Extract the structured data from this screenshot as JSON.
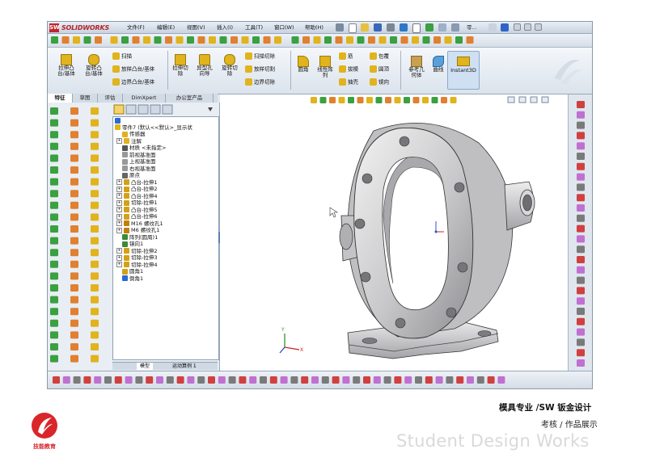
{
  "app": {
    "logo_text": "SOLIDWORKS",
    "menu": [
      "文件(F)",
      "编辑(E)",
      "视图(V)",
      "插入(I)",
      "工具(T)",
      "窗口(W)",
      "帮助(H)"
    ],
    "search_placeholder": "零..."
  },
  "command_manager": {
    "big_buttons": [
      {
        "line1": "拉伸凸",
        "line2": "台/基体"
      },
      {
        "line1": "旋转凸",
        "line2": "台/基体"
      },
      {
        "line1": "拉伸切",
        "line2": "除"
      },
      {
        "line1": "异型孔",
        "line2": "向导"
      },
      {
        "line1": "旋转切",
        "line2": "除"
      }
    ],
    "small_group1": [
      "扫描",
      "放样凸台/基体",
      "边界凸台/基体"
    ],
    "small_group2": [
      "扫描切除",
      "放样切割",
      "边界切除"
    ],
    "features_col1": [
      "圆角"
    ],
    "features_col2": {
      "line1": "线性阵",
      "line2": "列"
    },
    "features_col3": [
      "筋",
      "拔模",
      "抽壳"
    ],
    "features_col4": [
      "包覆",
      "圆顶",
      "镜向"
    ],
    "ref_geometry": {
      "line1": "参考几",
      "line2": "何体"
    },
    "curves": "曲线",
    "instant3d": "Instant3D"
  },
  "tabs": [
    "特征",
    "草图",
    "评估",
    "DimXpert",
    "办公室产品"
  ],
  "tree": {
    "root": "零件7 (默认<<默认>_显示状",
    "nodes": [
      {
        "label": "传感器",
        "expand": "",
        "color": "#e0b020"
      },
      {
        "label": "注解",
        "expand": "+",
        "color": "#e0b020"
      },
      {
        "label": "材质 <未指定>",
        "expand": "",
        "color": "#555555"
      },
      {
        "label": "前视基准面",
        "expand": "",
        "color": "#999999"
      },
      {
        "label": "上视基准面",
        "expand": "",
        "color": "#999999"
      },
      {
        "label": "右视基准面",
        "expand": "",
        "color": "#999999"
      },
      {
        "label": "原点",
        "expand": "",
        "color": "#666666"
      },
      {
        "label": "凸台-拉伸1",
        "expand": "+",
        "color": "#d4a017"
      },
      {
        "label": "凸台-拉伸2",
        "expand": "+",
        "color": "#d4a017"
      },
      {
        "label": "凸台-拉伸4",
        "expand": "+",
        "color": "#d4a017"
      },
      {
        "label": "切除-拉伸1",
        "expand": "+",
        "color": "#d4a017"
      },
      {
        "label": "凸台-拉伸5",
        "expand": "+",
        "color": "#d4a017"
      },
      {
        "label": "凸台-拉伸6",
        "expand": "+",
        "color": "#d4a017"
      },
      {
        "label": "M16 螺纹孔1",
        "expand": "+",
        "color": "#c08010"
      },
      {
        "label": "M6 螺纹孔1",
        "expand": "+",
        "color": "#c08010"
      },
      {
        "label": "阵列(圆周)1",
        "expand": "",
        "color": "#3a8a3a"
      },
      {
        "label": "镜向1",
        "expand": "",
        "color": "#3a8a3a"
      },
      {
        "label": "切除-拉伸2",
        "expand": "+",
        "color": "#d4a017"
      },
      {
        "label": "切除-拉伸3",
        "expand": "+",
        "color": "#d4a017"
      },
      {
        "label": "切除-拉伸4",
        "expand": "+",
        "color": "#d4a017"
      },
      {
        "label": "圆角1",
        "expand": "",
        "color": "#d4a017"
      },
      {
        "label": "倒角1",
        "expand": "",
        "color": "#2a6ad4"
      }
    ],
    "bottom_tabs": [
      "模型",
      "运动算例 1"
    ]
  },
  "captions": {
    "line1": "模具专业 /SW 钣金设计",
    "line2": "考核 / 作品展示",
    "line3": "Student Design Works"
  },
  "brand": {
    "text": "技能教育",
    "color": "#d9262b"
  }
}
